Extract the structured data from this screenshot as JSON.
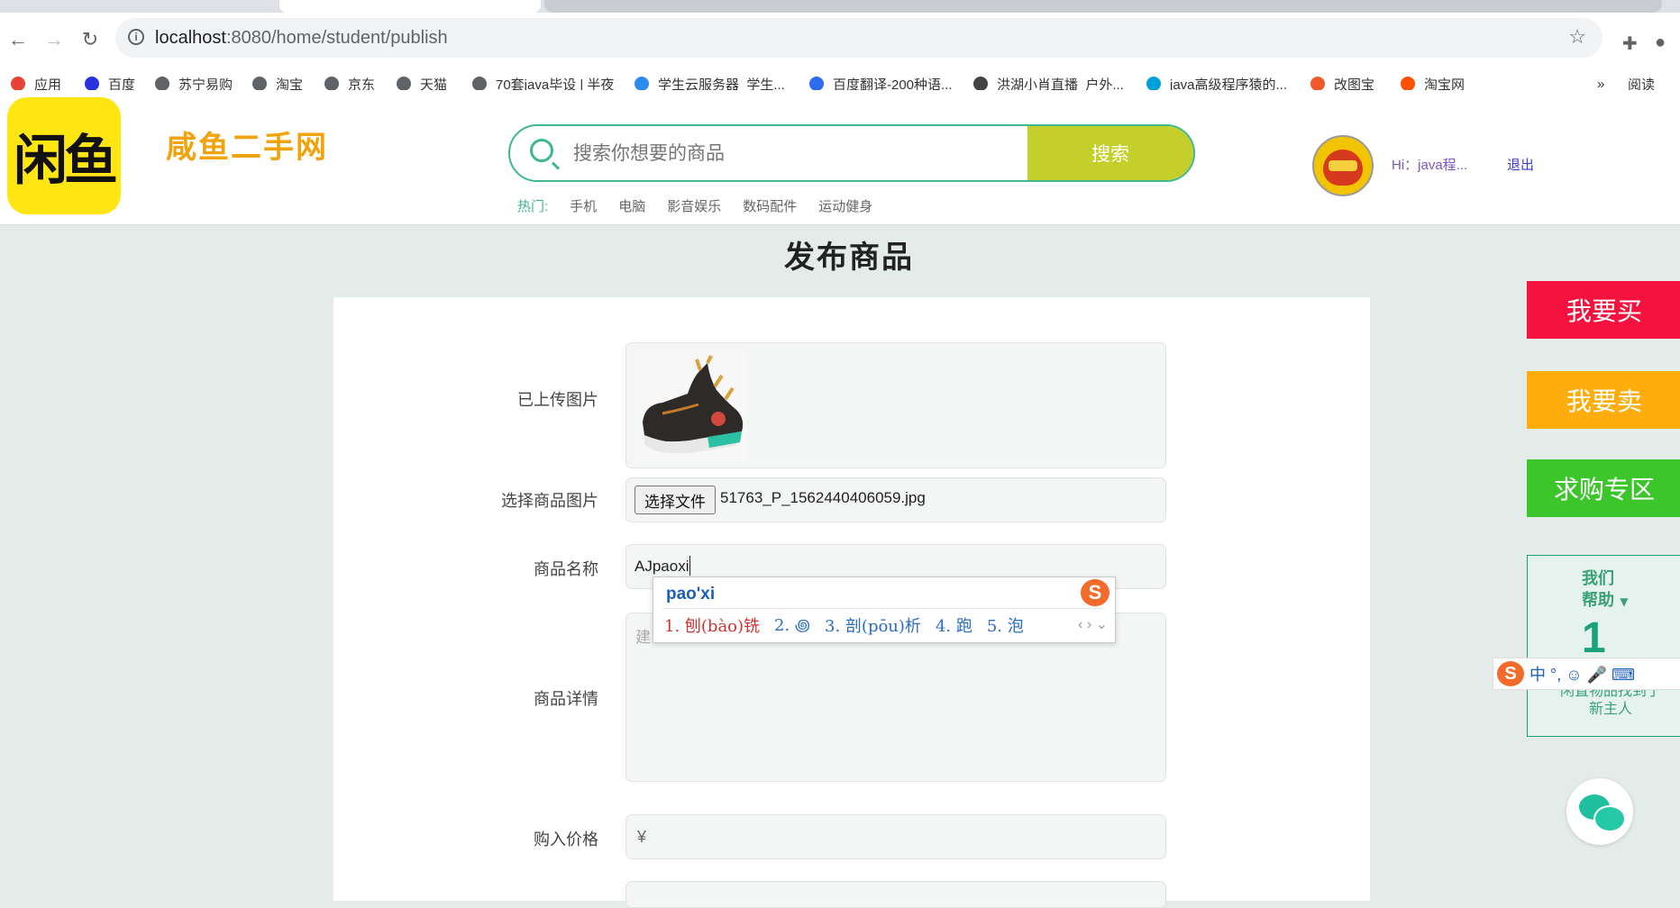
{
  "browser": {
    "url_host": "localhost",
    "url_path": ":8080/home/student/publish",
    "bookmarks": [
      {
        "label": "应用",
        "color": "#e94235"
      },
      {
        "label": "百度",
        "color": "#2932e1"
      },
      {
        "label": "苏宁易购",
        "color": "#5f6368"
      },
      {
        "label": "淘宝",
        "color": "#5f6368"
      },
      {
        "label": "京东",
        "color": "#5f6368"
      },
      {
        "label": "天猫",
        "color": "#5f6368"
      },
      {
        "label": "70套java毕设 | 半夜",
        "color": "#5f6368"
      },
      {
        "label": "学生云服务器_学生...",
        "color": "#2d8cf0"
      },
      {
        "label": "百度翻译-200种语...",
        "color": "#2d6cf0"
      },
      {
        "label": "洪湖小肖直播_户外...",
        "color": "#444"
      },
      {
        "label": "java高级程序猿的...",
        "color": "#00a1d6"
      },
      {
        "label": "改图宝",
        "color": "#f05a28"
      },
      {
        "label": "淘宝网",
        "color": "#ff5000"
      }
    ],
    "more_label": "»",
    "reading_label": "阅读"
  },
  "header": {
    "logo_text": "闲鱼",
    "site_title": "咸鱼二手网",
    "search_placeholder": "搜索你想要的商品",
    "search_button": "搜索",
    "hot_label": "热门:",
    "hot_items": [
      "手机",
      "电脑",
      "影音娱乐",
      "数码配件",
      "运动健身"
    ],
    "user_greeting": "Hi：java程...",
    "logout": "退出"
  },
  "page": {
    "title": "发布商品",
    "uploaded_label": "已上传图片",
    "choose_label": "选择商品图片",
    "choose_button": "选择文件",
    "file_name": "51763_P_1562440406059.jpg",
    "name_label": "商品名称",
    "name_value": "AJpaoxi",
    "detail_label": "商品详情",
    "detail_placeholder": "建",
    "price_label": "购入价格",
    "price_symbol": "¥"
  },
  "ime": {
    "composition": "pao'xi",
    "candidates": [
      "1. 刨(bào)铣",
      "2. ꩜",
      "3. 剖(pōu)析",
      "4. 跑",
      "5. 泡"
    ],
    "arrows": "‹ › ⌄",
    "logo": "S"
  },
  "sidebar": {
    "buy": "我要买",
    "sell": "我要卖",
    "want": "求购专区",
    "buy_color": "#f5123f",
    "sell_color": "#ffad0d",
    "want_color": "#3cc62b",
    "help_title_1": "我们",
    "help_title_2": "帮助",
    "help_number": "1",
    "help_body_1": "闲置物品找到了",
    "help_body_2": "新主人",
    "ime_bar": "中 °, ☺ 🎤 ⌨"
  }
}
